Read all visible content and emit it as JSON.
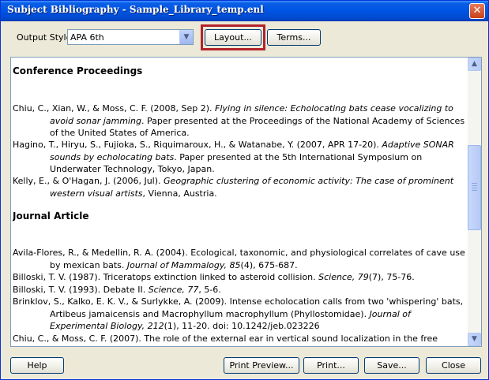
{
  "window": {
    "title": "Subject Bibliography - Sample_Library_temp.enl",
    "close_glyph": "✕"
  },
  "toolbar": {
    "output_style_label": "Output Style:",
    "output_style_value": "APA 6th",
    "layout_label": "Layout...",
    "terms_label": "Terms..."
  },
  "content": {
    "sections": [
      {
        "heading": "Conference Proceedings",
        "refs": [
          {
            "pre": "Chiu, C., Xian, W., & Moss, C. F. (2008, Sep 2). ",
            "title": "Flying in silence: Echolocating bats cease vocalizing to avoid sonar jamming",
            "post": ". Paper presented at the Proceedings of the National Academy of Sciences of the United States of America."
          },
          {
            "pre": "Hagino, T., Hiryu, S., Fujioka, S., Riquimaroux, H., & Watanabe, Y. (2007, APR 17-20). ",
            "title": "Adaptive SONAR sounds by echolocating bats",
            "post": ". Paper presented at the 5th International Symposium on Underwater Technology, Tokyo, Japan."
          },
          {
            "pre": "Kelly, E., & O'Hagan, J. (2006, Jul). ",
            "title": "Geographic clustering of economic activity: The case of prominent western visual artists",
            "post": ", Vienna, Austria."
          }
        ]
      },
      {
        "heading": "Journal Article",
        "refs": [
          {
            "pre": "Avila-Flores, R., & Medellin, R. A. (2004). Ecological, taxonomic, and physiological correlates of cave use by mexican bats. ",
            "title": "Journal of Mammalogy, 85",
            "post": "(4), 675-687."
          },
          {
            "pre": "Billoski, T. V. (1987). Triceratops extinction linked to asteroid collision. ",
            "title": "Science, 79",
            "post": "(7), 75-76."
          },
          {
            "pre": "Billoski, T. V. (1993). Debate II. ",
            "title": "Science, 77",
            "post": ", 5-6."
          },
          {
            "pre": "Brinklov, S., Kalko, E. K. V., & Surlykke, A. (2009). Intense echolocation calls from two 'whispering' bats, Artibeus jamaicensis and Macrophyllum macrophyllum (Phyllostomidae). ",
            "title": "Journal of Experimental Biology, 212",
            "post": "(1), 11-20. doi: 10.1242/jeb.023226"
          },
          {
            "pre": "Chiu, C., & Moss, C. F. (2007). The role of the external ear in vertical sound localization in the free",
            "title": "",
            "post": ""
          }
        ]
      }
    ]
  },
  "scrollbar": {
    "up_glyph": "▲",
    "down_glyph": "▼",
    "position_fraction": 0.42
  },
  "footer": {
    "help_label": "Help",
    "print_preview_label": "Print Preview...",
    "print_label": "Print...",
    "save_label": "Save...",
    "close_label": "Close"
  },
  "colors": {
    "titlebar": "#0054e3",
    "dialog_bg": "#ece9d8",
    "highlight": "#b3232b"
  }
}
